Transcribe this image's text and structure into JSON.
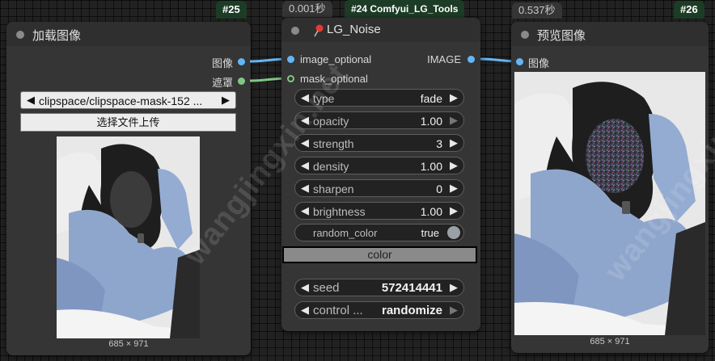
{
  "colors": {
    "canvas": "#222222",
    "node_body": "#353535",
    "node_header": "#2f2f2f",
    "badge_bg": "#1c3c26",
    "image_link": "#64b5f6",
    "mask_link": "#81c784"
  },
  "load_node": {
    "badge": "#25",
    "title": "加载图像",
    "out_image": "图像",
    "out_mask": "遮罩",
    "file_value": "clipspace/clipspace-mask-152 ...",
    "upload_label": "选择文件上传",
    "image_size": "685 × 971"
  },
  "noise_node": {
    "time": "0.001秒",
    "badge": "#24 Comfyui_LG_Tools",
    "title_icon": "pushpin-icon",
    "title": "LG_Noise",
    "in_image": "image_optional",
    "in_mask": "mask_optional",
    "out_image": "IMAGE",
    "widgets": [
      {
        "label": "type",
        "value": "fade"
      },
      {
        "label": "opacity",
        "value": "1.00"
      },
      {
        "label": "strength",
        "value": "3"
      },
      {
        "label": "density",
        "value": "1.00"
      },
      {
        "label": "sharpen",
        "value": "0"
      },
      {
        "label": "brightness",
        "value": "1.00"
      }
    ],
    "toggle": {
      "label": "random_color",
      "value": "true"
    },
    "color_button": "color",
    "seed": {
      "label": "seed",
      "value": "572414441"
    },
    "control": {
      "label": "control ...",
      "value": "randomize"
    }
  },
  "preview_node": {
    "time": "0.537秒",
    "badge": "#26",
    "title": "预览图像",
    "in_image": "图像",
    "image_size": "685 × 971"
  },
  "watermark": "wangjingxin.net"
}
